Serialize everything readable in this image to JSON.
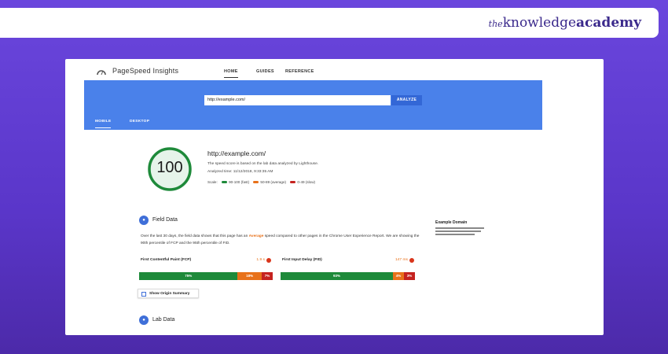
{
  "brand": {
    "prefix": "the",
    "name_regular": "knowledge",
    "name_bold": "academy"
  },
  "nav": {
    "title": "PageSpeed Insights",
    "tabs": [
      "HOME",
      "GUIDES",
      "REFERENCE"
    ]
  },
  "search": {
    "url_value": "http://example.com/",
    "analyze_label": "ANALYZE"
  },
  "device_tabs": [
    "MOBILE",
    "DESKTOP"
  ],
  "score": {
    "value": "100",
    "url": "http://example.com/",
    "lab_note": "The speed score is based on the lab data analyzed by Lighthouse.",
    "analyzed": "Analyzed time: 11/12/2018, 9:33:35 AM",
    "legend_label": "Scale:",
    "legend": [
      {
        "label": "90-100 (fast)",
        "color": "#1e8a3a"
      },
      {
        "label": "50-89 (average)",
        "color": "#e8711a"
      },
      {
        "label": "0-49 (slow)",
        "color": "#c5221f"
      }
    ]
  },
  "field_data": {
    "title": "Field Data",
    "desc_before": "Over the last 30 days, the field data shows that this page has an",
    "desc_highlight": "Average",
    "desc_after": "speed compared to other pages in the Chrome User Experience Report. We are showing the 90th percentile of FCP and the 95th percentile of FID.",
    "metrics": [
      {
        "label": "First Contentful Paint (FCP)",
        "value": "1.9 s",
        "distribution": [
          {
            "label": "75%",
            "value": 75,
            "type": "good"
          },
          {
            "label": "18%",
            "value": 18,
            "type": "avg"
          },
          {
            "label": "7%",
            "value": 7,
            "type": "poor"
          }
        ]
      },
      {
        "label": "First Input Delay (FID)",
        "value": "147 ms",
        "distribution": [
          {
            "label": "93%",
            "value": 93,
            "type": "good"
          },
          {
            "label": "4%",
            "value": 4,
            "type": "avg"
          },
          {
            "label": "3%",
            "value": 3,
            "type": "poor"
          }
        ]
      }
    ],
    "origin_button": "Show Origin Summary"
  },
  "lab_data": {
    "title": "Lab Data"
  },
  "side_panel": {
    "title": "Example Domain"
  },
  "colors": {
    "header_blue": "#4a81ea",
    "good": "#1e8a3a",
    "average": "#e8711a",
    "poor": "#c5221f",
    "background": "#6a46dd"
  }
}
